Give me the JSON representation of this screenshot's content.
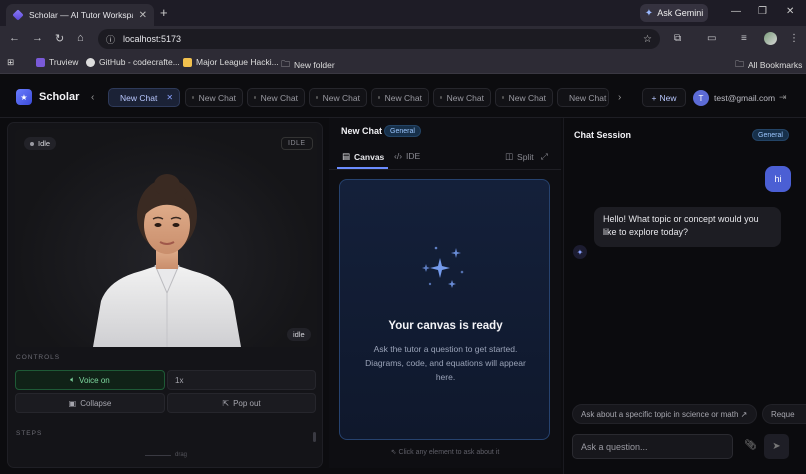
{
  "browser": {
    "tab_title": "Scholar — AI Tutor Workspace",
    "ask_gemini": "Ask Gemini",
    "url": "localhost:5173",
    "bookmarks": [
      "Truview",
      "GitHub - codecrafte...",
      "Major League Hacki...",
      "New folder"
    ],
    "all_bookmarks": "All Bookmarks"
  },
  "app": {
    "brand": "Scholar",
    "chat_tabs": [
      "New Chat",
      "New Chat",
      "New Chat",
      "New Chat",
      "New Chat",
      "New Chat",
      "New Chat",
      "New Chat"
    ],
    "new_label": "New",
    "user_initial": "T",
    "user_email": "test@gmail.com"
  },
  "left": {
    "status_pill": "Idle",
    "status_badge": "IDLE",
    "avatar_state": "idle",
    "controls_label": "CONTROLS",
    "voice_label": "Voice on",
    "speed": "1x",
    "collapse_label": "Collapse",
    "popout_label": "Pop out",
    "steps_label": "STEPS",
    "drag_label": "drag"
  },
  "middle": {
    "title": "New Chat",
    "badge": "General",
    "tab_canvas": "Canvas",
    "tab_ide": "IDE",
    "split_label": "Split",
    "canvas_heading": "Your canvas is ready",
    "canvas_text": "Ask the tutor a question to get started. Diagrams, code, and equations will appear here.",
    "canvas_footer": "Click any element to ask about it"
  },
  "right": {
    "title": "Chat Session",
    "badge": "General",
    "user_message": "hi",
    "assistant_message": "Hello! What topic or concept would you like to explore today?",
    "suggestions": [
      "Ask about a specific topic in science or math ↗",
      "Reque"
    ],
    "input_placeholder": "Ask a question..."
  }
}
